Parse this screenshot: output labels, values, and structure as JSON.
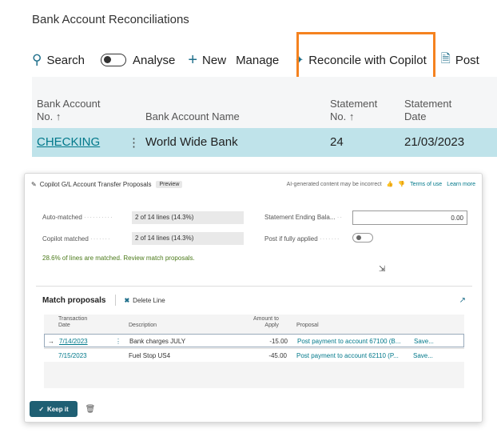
{
  "page": {
    "title": "Bank Account Reconciliations"
  },
  "toolbar": {
    "search": "Search",
    "analyse": "Analyse",
    "new": "New",
    "manage": "Manage",
    "reconcile": "Reconcile with Copilot",
    "post": "Post"
  },
  "grid": {
    "columns": {
      "bank_no": "Bank Account\nNo. ↑",
      "bank_name": "Bank Account Name",
      "stmt_no": "Statement\nNo. ↑",
      "stmt_date": "Statement\nDate"
    },
    "row": {
      "bank_no": "CHECKING",
      "bank_name": "World Wide Bank",
      "stmt_no": "24",
      "stmt_date": "21/03/2023"
    }
  },
  "dialog": {
    "title": "Copilot G/L Account Transfer Proposals",
    "badge": "Preview",
    "disclaimer": "AI-generated content may be incorrect",
    "terms": "Terms of use",
    "learn": "Learn more",
    "auto_matched_label": "Auto-matched",
    "auto_matched_value": "2 of 14 lines (14.3%)",
    "copilot_matched_label": "Copilot matched",
    "copilot_matched_value": "2 of 14 lines (14.3%)",
    "stmt_end_label": "Statement Ending Bala...",
    "stmt_end_value": "0.00",
    "post_if_label": "Post if fully applied",
    "summary_msg": "28.6% of lines are matched. Review match proposals.",
    "match_title": "Match proposals",
    "delete_line": "Delete Line",
    "headers": {
      "date": "Transaction\nDate",
      "desc": "Description",
      "amount": "Amount to\nApply",
      "proposal": "Proposal"
    },
    "rows": [
      {
        "date": "7/14/2023",
        "desc": "Bank charges JULY",
        "amount": "-15.00",
        "proposal": "Post payment to account 67100 (B...",
        "save": "Save..."
      },
      {
        "date": "7/15/2023",
        "desc": "Fuel Stop US4",
        "amount": "-45.00",
        "proposal": "Post payment to account 62110 (P...",
        "save": "Save..."
      }
    ],
    "keep": "Keep it"
  }
}
